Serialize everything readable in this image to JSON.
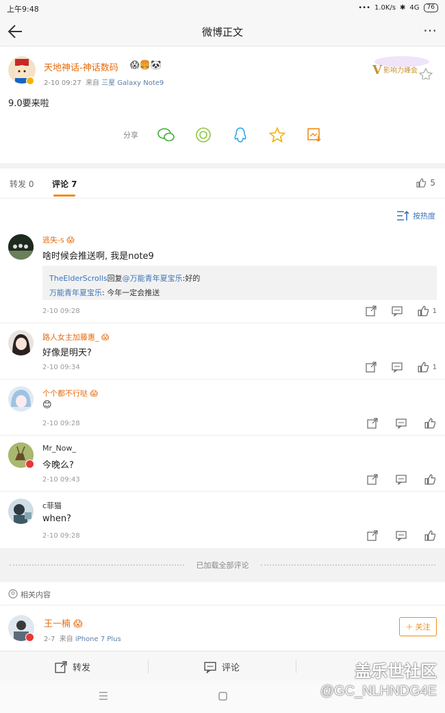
{
  "status_bar": {
    "time": "上午9:48",
    "speed": "1.0K/s",
    "network": "4G",
    "battery": "76"
  },
  "header": {
    "title": "微博正文"
  },
  "post": {
    "author": "天地神话-神话数码",
    "time": "2-10 09:27",
    "source_prefix": "来自",
    "source": "三星 Galaxy Note9",
    "text": "9.0要来啦",
    "badge_text": "影响力峰会",
    "share_label": "分享"
  },
  "tabs": {
    "repost": "转发 0",
    "comment": "评论 7",
    "likes": "5"
  },
  "sort_label": "按热度",
  "comments": [
    {
      "name": "逃失-s",
      "text": "啥时候会推送啊, 我是note9",
      "time": "2-10 09:28",
      "likes": "1",
      "reply1_user": "TheElderScrolls",
      "reply1_mid": "回复",
      "reply1_at": "@万能青年夏宝乐",
      "reply1_text": ":好的",
      "reply2_user": "万能青年夏宝乐",
      "reply2_text": ": 今年一定会推送"
    },
    {
      "name": "路人女主加藤惠_",
      "text": "好像是明天?",
      "time": "2-10 09:34",
      "likes": "1"
    },
    {
      "name": "个个都不行哒",
      "text": "",
      "time": "2-10 09:28"
    },
    {
      "name": "Mr_Now_",
      "text": "今晚么?",
      "time": "2-10 09:43"
    },
    {
      "name": "c菲猫",
      "text": "when?",
      "time": "2-10 09:28"
    }
  ],
  "loaded_text": "已加载全部评论",
  "related_label": "相关内容",
  "related_user": {
    "name": "王一楠",
    "time": "2-7",
    "source_prefix": "来自",
    "source": "iPhone 7 Plus",
    "follow": "关注"
  },
  "bottom": {
    "repost": "转发",
    "comment": "评论"
  },
  "watermark": {
    "line1": "盖乐世社区",
    "line2": "@GC_NLHNDG4E"
  },
  "colors": {
    "accent": "#f08c17",
    "name_orange": "#e86b0c",
    "link": "#3a74b8"
  }
}
